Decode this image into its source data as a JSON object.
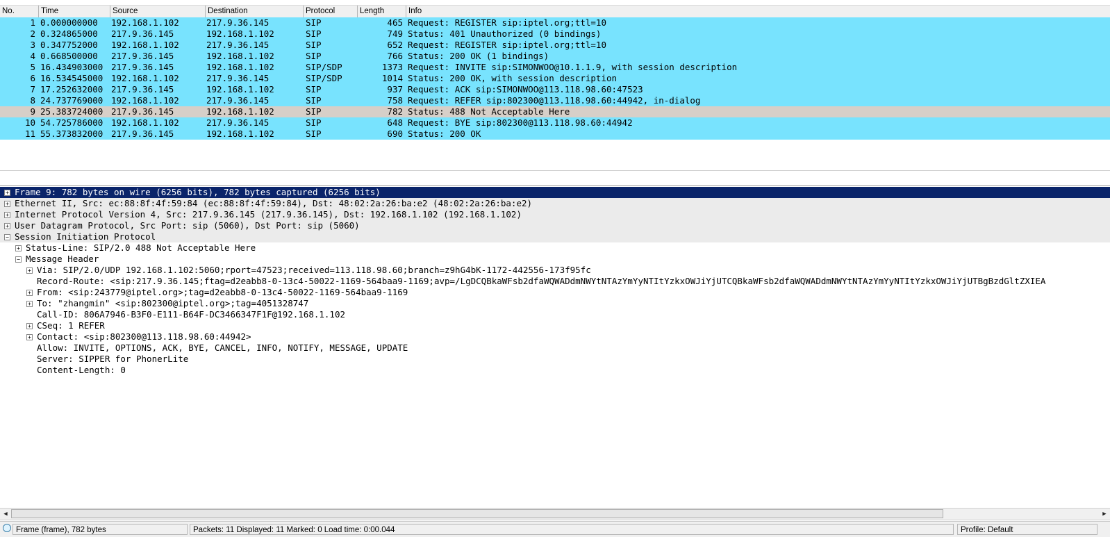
{
  "columns": [
    "No.",
    "Time",
    "Source",
    "Destination",
    "Protocol",
    "Length",
    "Info"
  ],
  "packets": [
    {
      "no": "1",
      "time": "0.000000000",
      "src": "192.168.1.102",
      "dst": "217.9.36.145",
      "proto": "SIP",
      "len": "465",
      "info": "Request: REGISTER sip:iptel.org;ttl=10"
    },
    {
      "no": "2",
      "time": "0.324865000",
      "src": "217.9.36.145",
      "dst": "192.168.1.102",
      "proto": "SIP",
      "len": "749",
      "info": "Status: 401 Unauthorized    (0 bindings)"
    },
    {
      "no": "3",
      "time": "0.347752000",
      "src": "192.168.1.102",
      "dst": "217.9.36.145",
      "proto": "SIP",
      "len": "652",
      "info": "Request: REGISTER sip:iptel.org;ttl=10"
    },
    {
      "no": "4",
      "time": "0.668500000",
      "src": "217.9.36.145",
      "dst": "192.168.1.102",
      "proto": "SIP",
      "len": "766",
      "info": "Status: 200 OK    (1 bindings)"
    },
    {
      "no": "5",
      "time": "16.434903000",
      "src": "217.9.36.145",
      "dst": "192.168.1.102",
      "proto": "SIP/SDP",
      "len": "1373",
      "info": "Request: INVITE sip:SIMONWOO@10.1.1.9, with session description"
    },
    {
      "no": "6",
      "time": "16.534545000",
      "src": "192.168.1.102",
      "dst": "217.9.36.145",
      "proto": "SIP/SDP",
      "len": "1014",
      "info": "Status: 200 OK, with session description"
    },
    {
      "no": "7",
      "time": "17.252632000",
      "src": "217.9.36.145",
      "dst": "192.168.1.102",
      "proto": "SIP",
      "len": "937",
      "info": "Request: ACK sip:SIMONWOO@113.118.98.60:47523"
    },
    {
      "no": "8",
      "time": "24.737769000",
      "src": "192.168.1.102",
      "dst": "217.9.36.145",
      "proto": "SIP",
      "len": "758",
      "info": "Request: REFER sip:802300@113.118.98.60:44942, in-dialog"
    },
    {
      "no": "9",
      "time": "25.383724000",
      "src": "217.9.36.145",
      "dst": "192.168.1.102",
      "proto": "SIP",
      "len": "782",
      "info": "Status: 488 Not Acceptable Here"
    },
    {
      "no": "10",
      "time": "54.725786000",
      "src": "192.168.1.102",
      "dst": "217.9.36.145",
      "proto": "SIP",
      "len": "648",
      "info": "Request: BYE sip:802300@113.118.98.60:44942"
    },
    {
      "no": "11",
      "time": "55.373832000",
      "src": "217.9.36.145",
      "dst": "192.168.1.102",
      "proto": "SIP",
      "len": "690",
      "info": "Status: 200 OK"
    }
  ],
  "details": [
    {
      "text": "Frame 9: 782 bytes on wire (6256 bits), 782 bytes captured (6256 bits)",
      "level": 0,
      "toggle": "+"
    },
    {
      "text": "Ethernet II, Src: ec:88:8f:4f:59:84 (ec:88:8f:4f:59:84), Dst: 48:02:2a:26:ba:e2 (48:02:2a:26:ba:e2)",
      "level": 0,
      "toggle": "+"
    },
    {
      "text": "Internet Protocol Version 4, Src: 217.9.36.145 (217.9.36.145), Dst: 192.168.1.102 (192.168.1.102)",
      "level": 0,
      "toggle": "+"
    },
    {
      "text": "User Datagram Protocol, Src Port: sip (5060), Dst Port: sip (5060)",
      "level": 0,
      "toggle": "+"
    },
    {
      "text": "Session Initiation Protocol",
      "level": 0,
      "toggle": "−"
    },
    {
      "text": "Status-Line: SIP/2.0 488 Not Acceptable Here",
      "level": 1,
      "toggle": "+"
    },
    {
      "text": "Message Header",
      "level": 1,
      "toggle": "−"
    },
    {
      "text": "Via: SIP/2.0/UDP 192.168.1.102:5060;rport=47523;received=113.118.98.60;branch=z9hG4bK-1172-442556-173f95fc",
      "level": 2,
      "toggle": "+"
    },
    {
      "text": "Record-Route: <sip:217.9.36.145;ftag=d2eabb8-0-13c4-50022-1169-564baa9-1169;avp=/LgDCQBkaWFsb2dfaWQWADdmNWYtNTAzYmYyNTItYzkxOWJiYjUTCQBkaWFsb2dfaWQWADdmNWYtNTAzYmYyNTItYzkxOWJiYjUTBgBzdGltZXIEA",
      "level": 2,
      "toggle": ""
    },
    {
      "text": "From: <sip:243779@iptel.org>;tag=d2eabb8-0-13c4-50022-1169-564baa9-1169",
      "level": 2,
      "toggle": "+"
    },
    {
      "text": "To: \"zhangmin\" <sip:802300@iptel.org>;tag=4051328747",
      "level": 2,
      "toggle": "+"
    },
    {
      "text": "Call-ID: 806A7946-B3F0-E111-B64F-DC3466347F1F@192.168.1.102",
      "level": 2,
      "toggle": ""
    },
    {
      "text": "CSeq: 1 REFER",
      "level": 2,
      "toggle": "+"
    },
    {
      "text": "Contact: <sip:802300@113.118.98.60:44942>",
      "level": 2,
      "toggle": "+"
    },
    {
      "text": "Allow: INVITE, OPTIONS, ACK, BYE, CANCEL, INFO, NOTIFY, MESSAGE, UPDATE",
      "level": 2,
      "toggle": ""
    },
    {
      "text": "Server: SIPPER for PhonerLite",
      "level": 2,
      "toggle": ""
    },
    {
      "text": "Content-Length: 0",
      "level": 2,
      "toggle": ""
    }
  ],
  "status": {
    "frame": "Frame (frame), 782 bytes",
    "packets": "Packets: 11 Displayed: 11 Marked: 0 Load time: 0:00.044",
    "profile": "Profile: Default"
  },
  "icons": {
    "scroll_left": "scroll-left-arrow-icon",
    "scroll_right": "scroll-right-arrow-icon",
    "expert_info": "expert-info-icon"
  },
  "colors": {
    "sip_row": "#78e3fe",
    "warn_row": "#d7cfc8",
    "selected_row": "#0a246a"
  }
}
